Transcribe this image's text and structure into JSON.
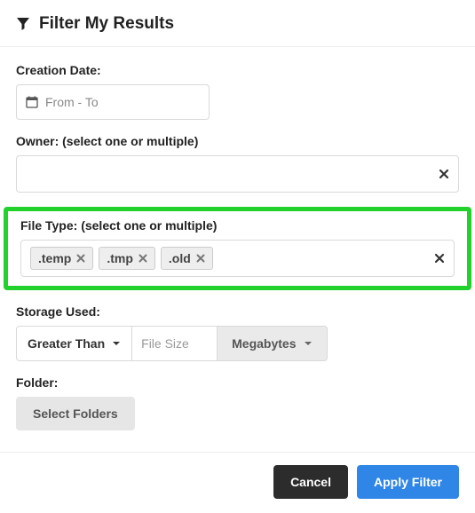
{
  "header": {
    "title": "Filter My Results"
  },
  "creationDate": {
    "label": "Creation Date:",
    "placeholder": "From - To"
  },
  "owner": {
    "label": "Owner: (select one or multiple)"
  },
  "fileType": {
    "label": "File Type: (select one or multiple)",
    "tags": [
      ".temp",
      ".tmp",
      ".old"
    ]
  },
  "storage": {
    "label": "Storage Used:",
    "comparator": "Greater Than",
    "sizePlaceholder": "File Size",
    "unit": "Megabytes"
  },
  "folder": {
    "label": "Folder:",
    "button": "Select Folders"
  },
  "footer": {
    "cancel": "Cancel",
    "apply": "Apply Filter"
  }
}
